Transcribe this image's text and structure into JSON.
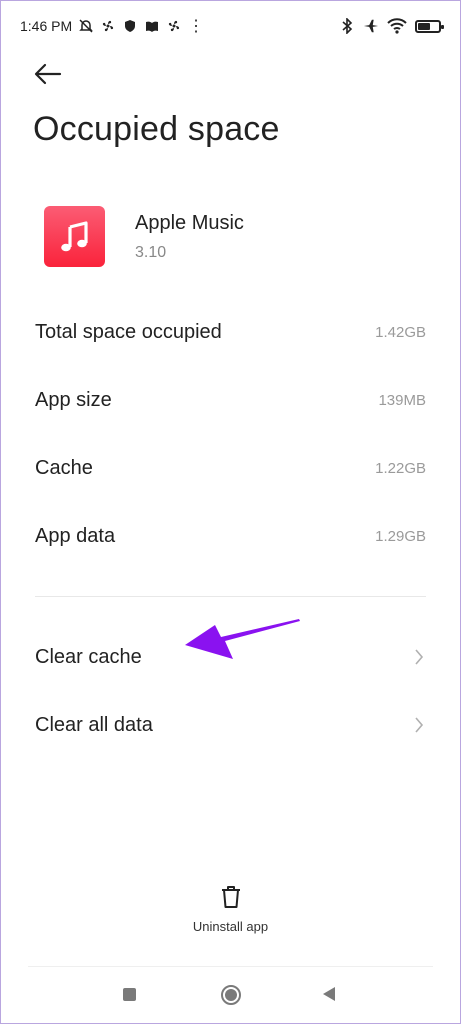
{
  "status_bar": {
    "time": "1:46 PM",
    "battery_level": 0.55
  },
  "page": {
    "title": "Occupied space"
  },
  "app": {
    "name": "Apple Music",
    "version": "3.10",
    "icon_color": "#fa2d48"
  },
  "storage": [
    {
      "label": "Total space occupied",
      "value": "1.42GB"
    },
    {
      "label": "App size",
      "value": "139MB"
    },
    {
      "label": "Cache",
      "value": "1.22GB"
    },
    {
      "label": "App data",
      "value": "1.29GB"
    }
  ],
  "actions": [
    {
      "label": "Clear cache"
    },
    {
      "label": "Clear all data"
    }
  ],
  "uninstall": {
    "label": "Uninstall app"
  },
  "annotation": {
    "arrow_color": "#8a12f0"
  }
}
